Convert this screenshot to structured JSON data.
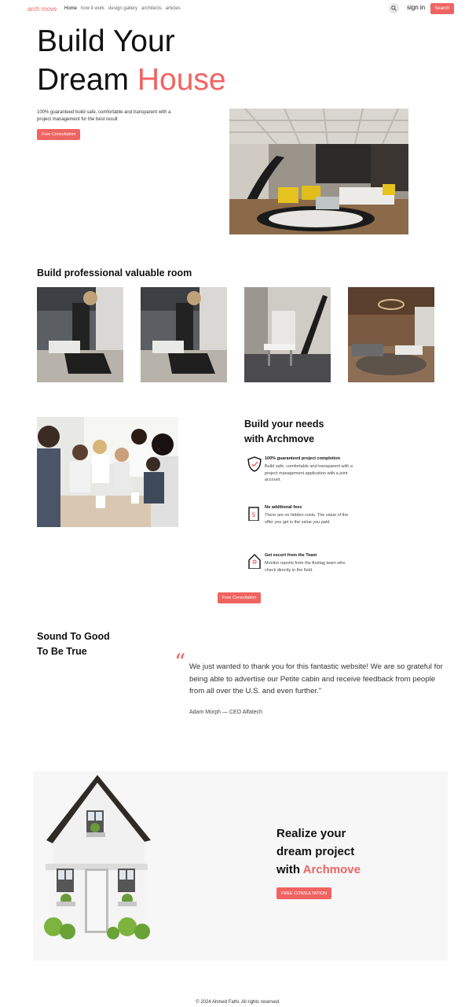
{
  "nav": {
    "brand": "arch move",
    "links": [
      "Home",
      "how it work",
      "design gallery",
      "architects",
      "articles"
    ],
    "signin": "sign in",
    "search_button": "Search"
  },
  "hero": {
    "title_line1": "Build Your",
    "title_line2_plain": "Dream ",
    "title_line2_accent": "House",
    "description": "100% guaranteed build safe, comfortable and transparent with a project management for the best result",
    "button": "Free Consultation"
  },
  "rooms": {
    "title": "Build professional valuable room"
  },
  "needs": {
    "title_line1": "Build your needs",
    "title_line2": "with Archmove",
    "features": [
      {
        "icon": "shield-check-icon",
        "title": "100% guaranteed project completion",
        "desc": "Build safe, comfortable and transparent with a project management application with a joint account."
      },
      {
        "icon": "dollar-document-icon",
        "title": "No additional fees",
        "desc": "There are no hidden costs. The value of the offer you get is the value you paid."
      },
      {
        "icon": "house-person-icon",
        "title": "Get escort from the Team",
        "desc": "Monitor reports from the Arsitag team who check directly in the field."
      }
    ],
    "button": "Free Consultation"
  },
  "testimonial": {
    "title_line1": "Sound To Good",
    "title_line2": "To Be True",
    "quote": "We just wanted to thank you for this fantastic website! We are so grateful for being able to advertise our Petite cabin and receive feedback from people from all over the U.S. and even further.\"",
    "author": "Adam Morph — CEO Alfatech"
  },
  "cta": {
    "line1": "Realize your",
    "line2": "dream project",
    "line3_plain": "with ",
    "line3_accent": "Archmove",
    "button": "FREE CONSULTATION"
  },
  "footer": {
    "text": "© 2024 Ahmed Fathi. All rights reserved."
  },
  "colors": {
    "accent": "#ef6461"
  }
}
